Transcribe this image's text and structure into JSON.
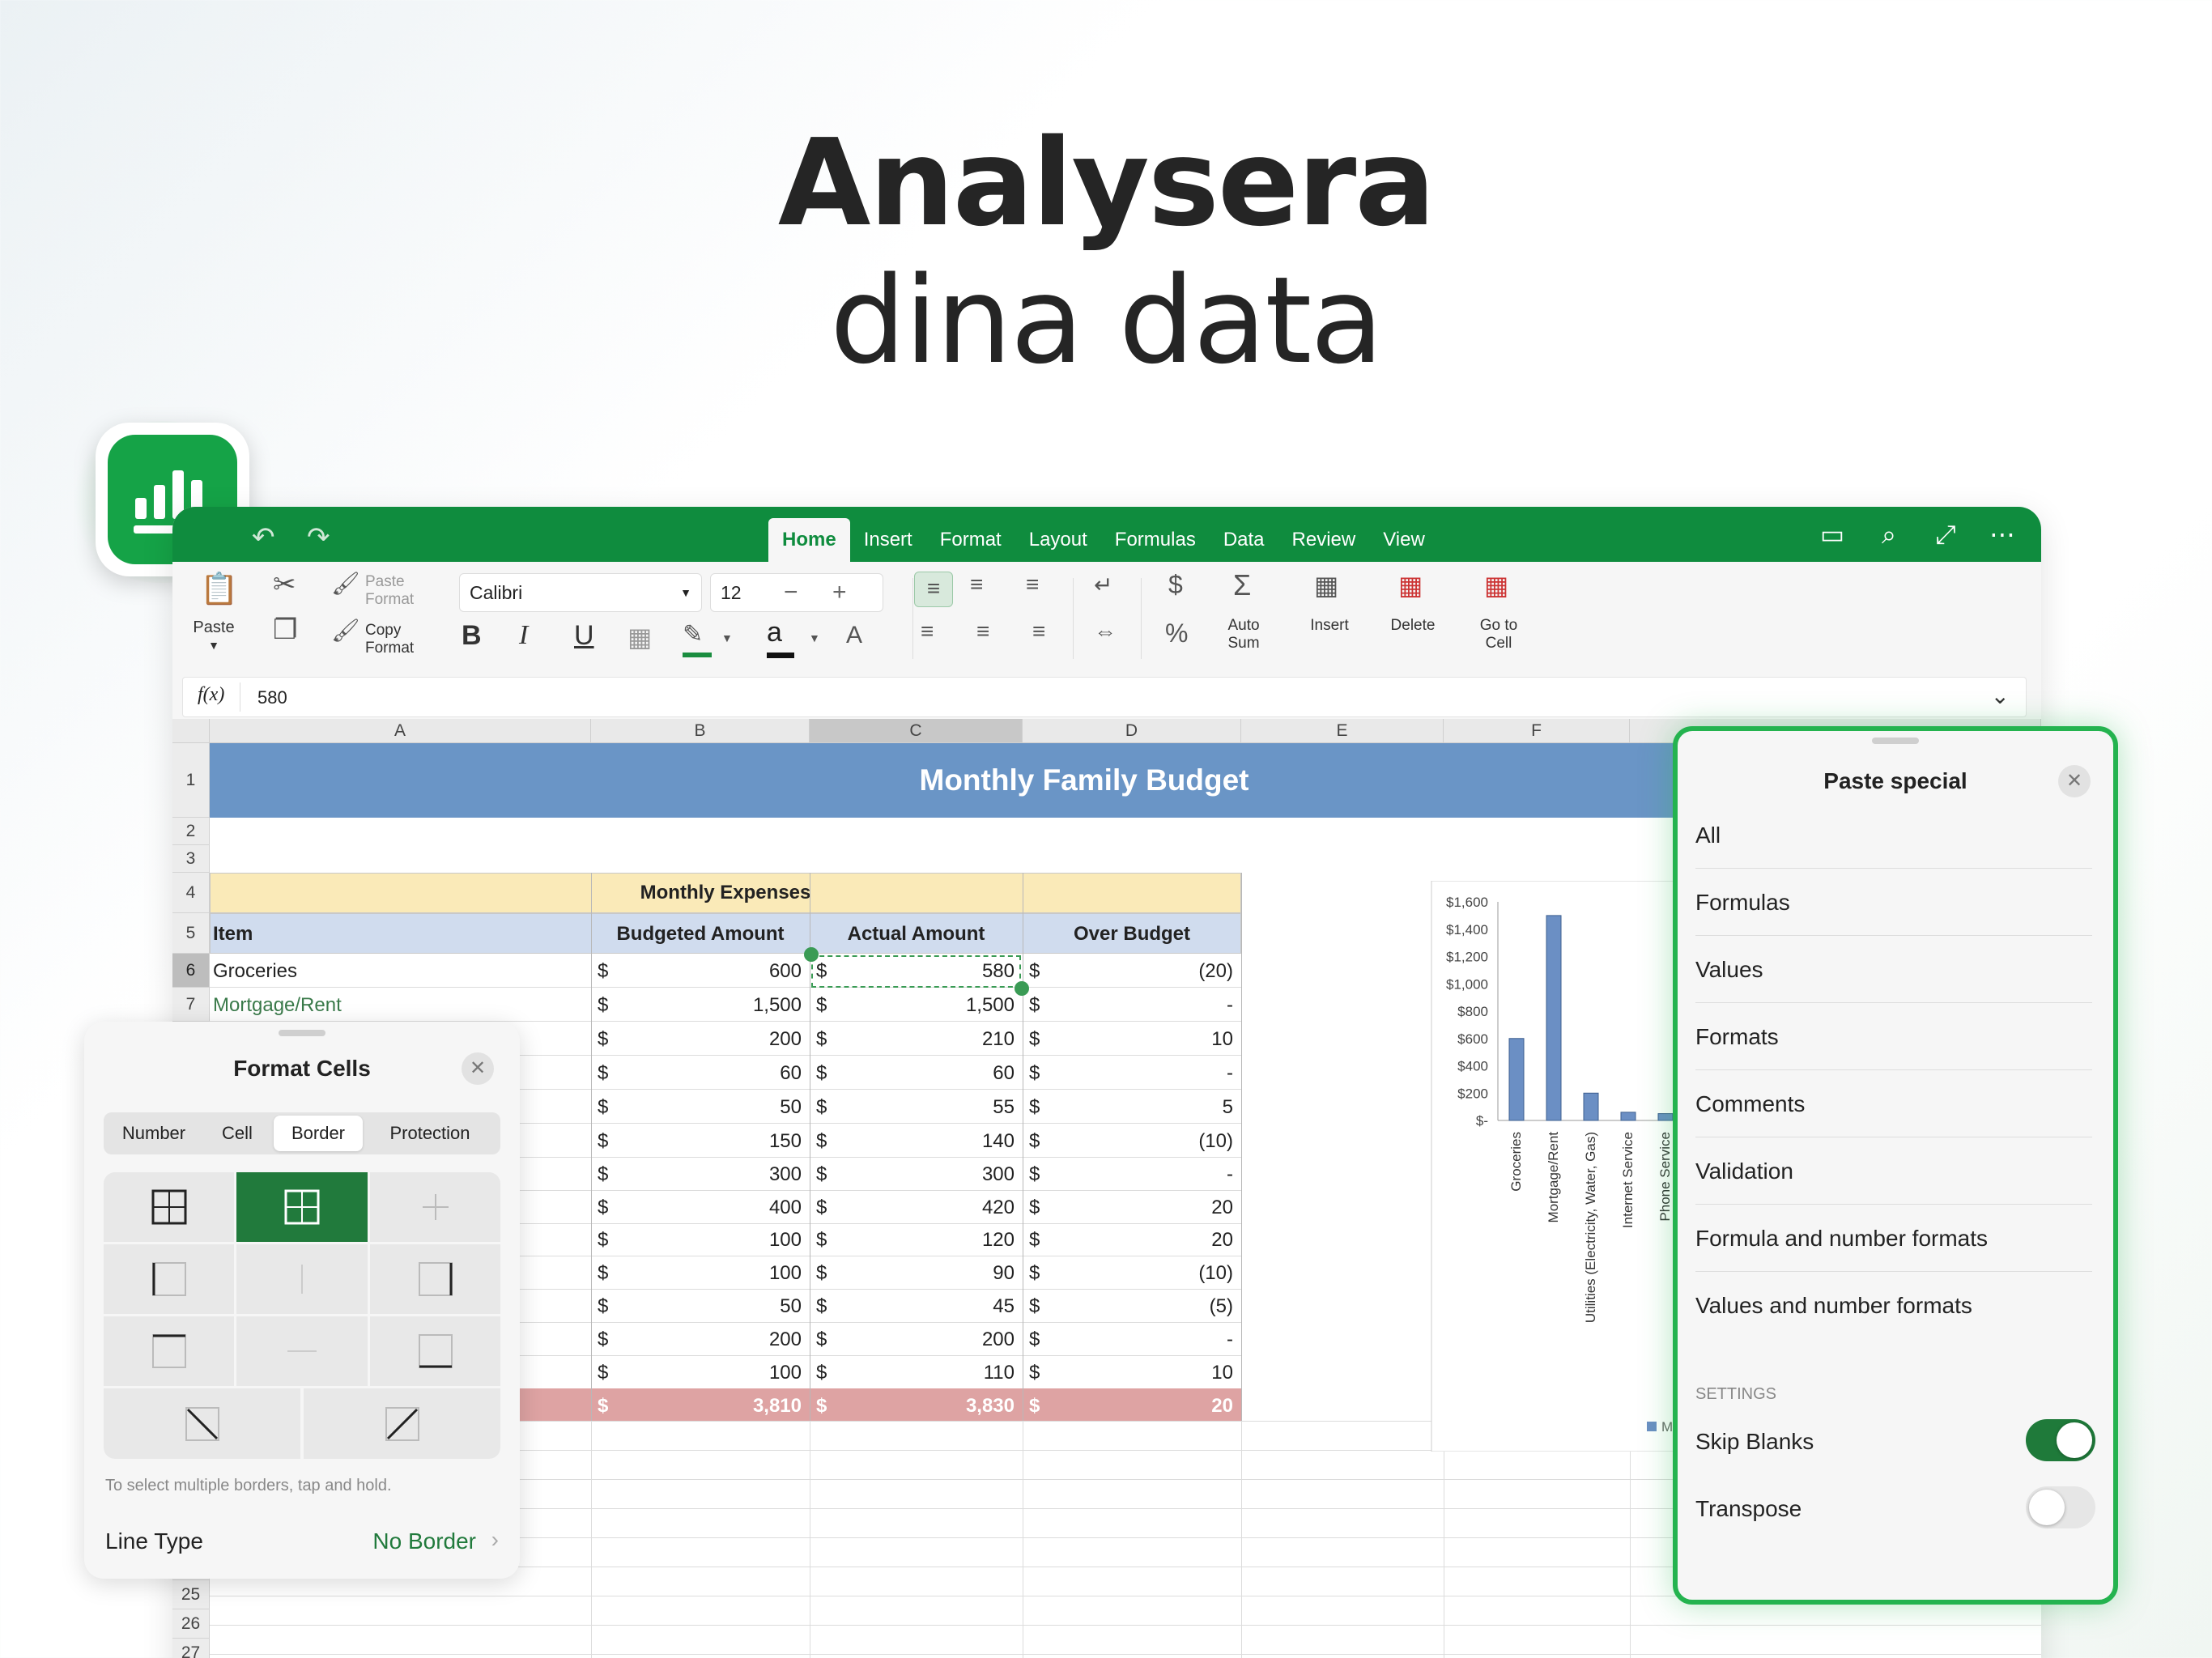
{
  "headline": {
    "line1": "Analysera",
    "line2": "dina data"
  },
  "app": {
    "tabs": [
      "Home",
      "Insert",
      "Format",
      "Layout",
      "Formulas",
      "Data",
      "Review",
      "View"
    ],
    "active_tab": "Home"
  },
  "ribbon": {
    "paste": "Paste",
    "paste_format_1": "Paste",
    "paste_format_2": "Format",
    "copy_format_1": "Copy",
    "copy_format_2": "Format",
    "font": "Calibri",
    "font_size": "12",
    "bold": "B",
    "italic": "I",
    "underline": "U",
    "font_color_letter": "a",
    "currency": "$",
    "percent": "%",
    "sigma": "Σ",
    "auto_sum_1": "Auto",
    "auto_sum_2": "Sum",
    "insert": "Insert",
    "delete": "Delete",
    "goto_1": "Go to",
    "goto_2": "Cell"
  },
  "formula_bar": {
    "fx": "f(x)",
    "value": "580"
  },
  "sheet": {
    "columns": [
      "A",
      "B",
      "C",
      "D",
      "E",
      "F"
    ],
    "rows_visible": [
      "1",
      "2",
      "3",
      "4",
      "5",
      "6",
      "7",
      "25",
      "26",
      "27"
    ],
    "title": "Monthly Family Budget",
    "section_header": "Monthly Expenses",
    "headers": {
      "item": "Item",
      "budgeted": "Budgeted Amount",
      "actual": "Actual Amount",
      "over": "Over Budget"
    },
    "currency_symbol": "$",
    "rows": [
      {
        "item": "Groceries",
        "budgeted": "600",
        "actual": "580",
        "over": "(20)"
      },
      {
        "item": "Mortgage/Rent",
        "budgeted": "1,500",
        "actual": "1,500",
        "over": "-"
      },
      {
        "item": "",
        "budgeted": "200",
        "actual": "210",
        "over": "10"
      },
      {
        "item": "",
        "budgeted": "60",
        "actual": "60",
        "over": "-"
      },
      {
        "item": "",
        "budgeted": "50",
        "actual": "55",
        "over": "5"
      },
      {
        "item": "t)",
        "budgeted": "150",
        "actual": "140",
        "over": "(10)"
      },
      {
        "item": "",
        "budgeted": "300",
        "actual": "300",
        "over": "-"
      },
      {
        "item": "",
        "budgeted": "400",
        "actual": "420",
        "over": "20"
      },
      {
        "item": "ıt)",
        "budgeted": "100",
        "actual": "120",
        "over": "20"
      },
      {
        "item": "",
        "budgeted": "100",
        "actual": "90",
        "over": "(10)"
      },
      {
        "item": "",
        "budgeted": "50",
        "actual": "45",
        "over": "(5)"
      },
      {
        "item": "",
        "budgeted": "200",
        "actual": "200",
        "over": "-"
      },
      {
        "item": "",
        "budgeted": "100",
        "actual": "110",
        "over": "10"
      }
    ],
    "total": {
      "budgeted": "3,810",
      "actual": "3,830",
      "over": "20"
    }
  },
  "chart_data": {
    "type": "bar",
    "categories": [
      "Groceries",
      "Mortgage/Rent",
      "Utilities (Electricity, Water, Gas)",
      "Internet Service",
      "Phone Service"
    ],
    "values": [
      600,
      1500,
      200,
      60,
      50
    ],
    "yticks": [
      "$1,600",
      "$1,400",
      "$1,200",
      "$1,000",
      "$800",
      "$600",
      "$400",
      "$200",
      "$-"
    ],
    "ylim": [
      0,
      1600
    ],
    "legend_text": "M",
    "bar_color": "#6b8fc4"
  },
  "format_cells": {
    "title": "Format Cells",
    "tabs": [
      "Number",
      "Cell",
      "Border",
      "Protection"
    ],
    "active_tab": "Border",
    "hint": "To select multiple borders, tap and hold.",
    "line_type_label": "Line Type",
    "line_type_value": "No Border"
  },
  "paste_special": {
    "title": "Paste special",
    "options": [
      "All",
      "Formulas",
      "Values",
      "Formats",
      "Comments",
      "Validation",
      "Formula and number formats",
      "Values and number formats"
    ],
    "settings_label": "SETTINGS",
    "skip_blanks": {
      "label": "Skip Blanks",
      "on": true
    },
    "transpose": {
      "label": "Transpose",
      "on": false
    }
  },
  "colors": {
    "brand_green": "#0f8c3e",
    "title_band": "#6a95c6",
    "section_header": "#faeab8",
    "header_row": "#d0dcee",
    "total_row": "#dea3a3"
  }
}
